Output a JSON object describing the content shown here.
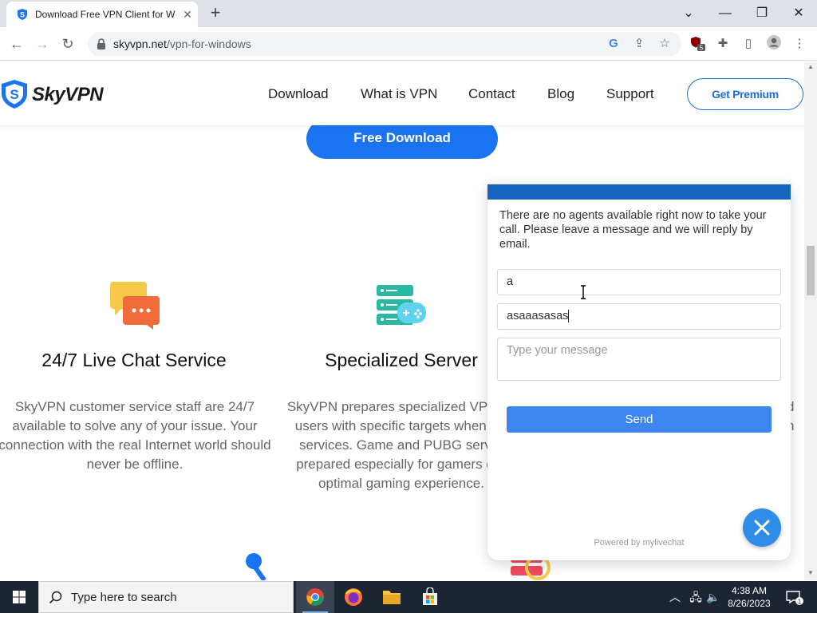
{
  "browser": {
    "tab_title": "Download Free VPN Client for W",
    "url_domain": "skyvpn.net",
    "url_path": "/vpn-for-windows",
    "extension_badge": "5"
  },
  "site": {
    "brand": "SkyVPN",
    "nav": [
      "Download",
      "What is VPN",
      "Contact",
      "Blog",
      "Support"
    ],
    "premium_label": "Get Premium",
    "free_download_label": "Free Download",
    "features": [
      {
        "title": "24/7 Live Chat Service",
        "desc": [
          "SkyVPN customer service staff are 24/7",
          "available to solve any of your issue. Your",
          "connection with the real Internet world should",
          "never be offline."
        ]
      },
      {
        "title": "Specialized Server",
        "desc": [
          "SkyVPN prepares specialized VPN se",
          "users with specific targets when usi",
          "services. Game and PUBG server",
          "prepared especially for gamers call",
          "optimal gaming experience."
        ]
      }
    ],
    "right_clip": [
      "d",
      "n",
      "l"
    ]
  },
  "chat": {
    "message": "There are no agents available right now to take your call. Please leave a message and we will reply by email.",
    "name_value": "a",
    "email_value": "asaaasasas",
    "message_placeholder": "Type your message",
    "send_label": "Send",
    "powered_by": "Powered by mylivechat"
  },
  "taskbar": {
    "search_placeholder": "Type here to search",
    "time": "4:38 AM",
    "date": "8/26/2023",
    "notification_count": "1"
  },
  "colors": {
    "brand_blue": "#1a73f0",
    "chat_header": "#1565c0",
    "send_button": "#3d86f0"
  }
}
